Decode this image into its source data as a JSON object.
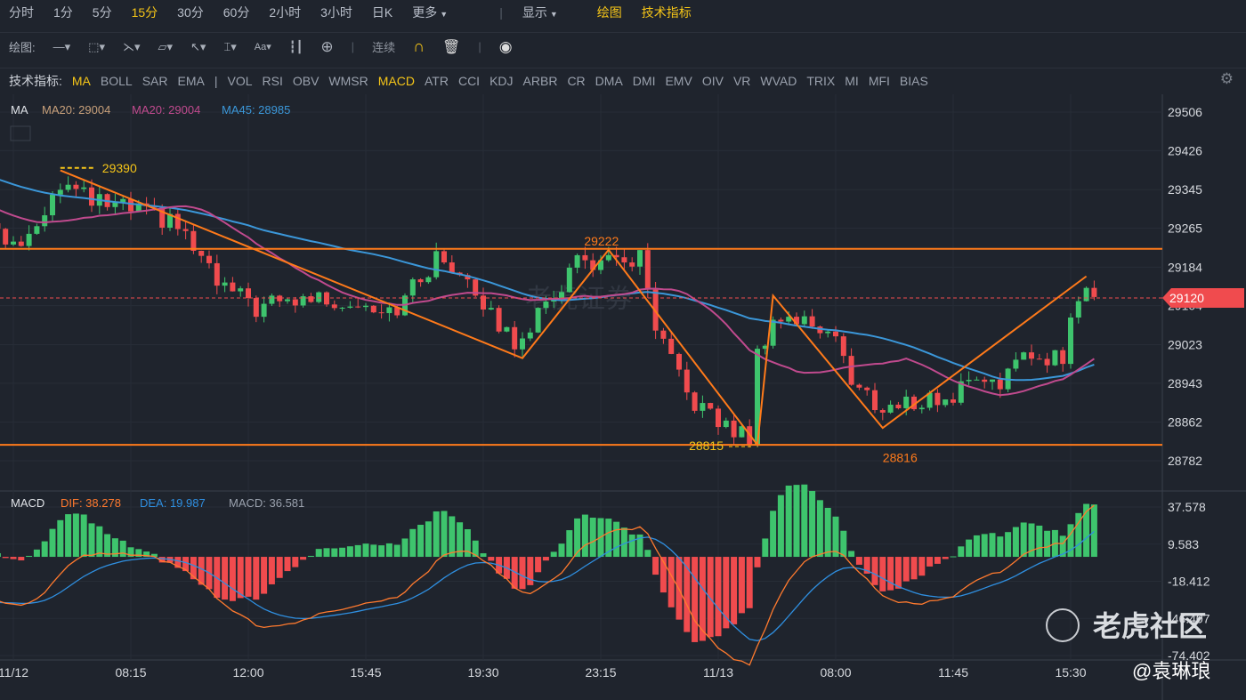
{
  "periods": [
    "分时",
    "1分",
    "5分",
    "15分",
    "30分",
    "60分",
    "2小时",
    "3小时",
    "日K"
  ],
  "active_period": "15分",
  "more_label": "更多",
  "display_label": "显示",
  "draw_label": "绘图",
  "indicator_label": "技术指标",
  "toolbar": {
    "title": "绘图:",
    "continuous": "连续"
  },
  "indicators": {
    "title": "技术指标:",
    "main": [
      "MA",
      "BOLL",
      "SAR",
      "EMA"
    ],
    "sub": [
      "VOL",
      "RSI",
      "OBV",
      "WMSR",
      "MACD",
      "ATR",
      "CCI",
      "KDJ",
      "ARBR",
      "CR",
      "DMA",
      "DMI",
      "EMV",
      "OIV",
      "VR",
      "WVAD",
      "TRIX",
      "MI",
      "MFI",
      "BIAS"
    ],
    "active": [
      "MA",
      "MACD"
    ]
  },
  "ma_legend": {
    "title": "MA",
    "ma20a": "MA20: 29004",
    "ma20b": "MA20: 29004",
    "ma45": "MA45: 28985"
  },
  "macd_legend": {
    "title": "MACD",
    "dif": "DIF: 38.278",
    "dea": "DEA: 19.987",
    "macd": "MACD: 36.581"
  },
  "watermark": "老虎证券",
  "brand": "老虎社区",
  "author": "@袁琳琅",
  "colors": {
    "up": "#3ec46d",
    "down": "#f04b4e",
    "ma20": "#c04a8e",
    "ma45": "#3b97d9",
    "drawing": "#ff7a1a",
    "dif": "#ff7a2e",
    "dea": "#2f8fe0",
    "label": "#f5c518"
  },
  "chart_data": {
    "type": "candlestick",
    "price_axis": {
      "ticks": [
        "29506",
        "29426",
        "29345",
        "29265",
        "29184",
        "29104",
        "29023",
        "28943",
        "28862",
        "28782"
      ],
      "range": [
        28782,
        29506
      ]
    },
    "current_price": "29120",
    "time_axis": {
      "labels": [
        "11/12",
        "08:15",
        "12:00",
        "15:45",
        "19:30",
        "23:15",
        "11/13",
        "08:00",
        "11:45",
        "15:30"
      ],
      "label_candle_index": [
        0,
        15,
        30,
        45,
        60,
        75,
        90,
        105,
        120,
        135
      ]
    },
    "price_path": [
      [
        -60,
        29560
      ],
      [
        -2,
        29250
      ],
      [
        1,
        29230
      ],
      [
        6,
        29360
      ],
      [
        10,
        29320
      ],
      [
        16,
        29300
      ],
      [
        21,
        29270
      ],
      [
        26,
        29150
      ],
      [
        31,
        29100
      ],
      [
        38,
        29120
      ],
      [
        44,
        29110
      ],
      [
        49,
        29100
      ],
      [
        54,
        29200
      ],
      [
        58,
        29170
      ],
      [
        61,
        29080
      ],
      [
        64,
        29030
      ],
      [
        68,
        29100
      ],
      [
        72,
        29200
      ],
      [
        76,
        29190
      ],
      [
        80,
        29200
      ],
      [
        82,
        29050
      ],
      [
        86,
        28920
      ],
      [
        90,
        28860
      ],
      [
        94,
        28830
      ],
      [
        95,
        29000
      ],
      [
        97,
        29080
      ],
      [
        101,
        29070
      ],
      [
        105,
        29050
      ],
      [
        107,
        28940
      ],
      [
        111,
        28890
      ],
      [
        117,
        28910
      ],
      [
        120,
        28910
      ],
      [
        122,
        28960
      ],
      [
        126,
        28950
      ],
      [
        130,
        29000
      ],
      [
        134,
        29000
      ],
      [
        136,
        29130
      ],
      [
        138,
        29120
      ]
    ],
    "levels": [
      {
        "price": 29222,
        "label": "29222"
      },
      {
        "price": 28815,
        "label": "28815"
      }
    ],
    "zigzag": [
      [
        6,
        29385
      ],
      [
        65,
        28995
      ],
      [
        76,
        29220
      ],
      [
        95,
        28815
      ],
      [
        97,
        29125
      ],
      [
        111,
        28850
      ],
      [
        137,
        29165
      ]
    ],
    "annotations": [
      {
        "text": "29390",
        "idx": 6,
        "price": 29390
      },
      {
        "text": "29222",
        "idx": 76,
        "price": 29222
      },
      {
        "text": "28815",
        "idx": 95,
        "price": 28815
      },
      {
        "text": "28816",
        "idx": 111,
        "price": 28816
      }
    ],
    "macd_axis": {
      "ticks": [
        "37.578",
        "9.583",
        "-18.412",
        "-46.407",
        "-74.402"
      ],
      "range": [
        -74.402,
        37.578
      ]
    }
  }
}
